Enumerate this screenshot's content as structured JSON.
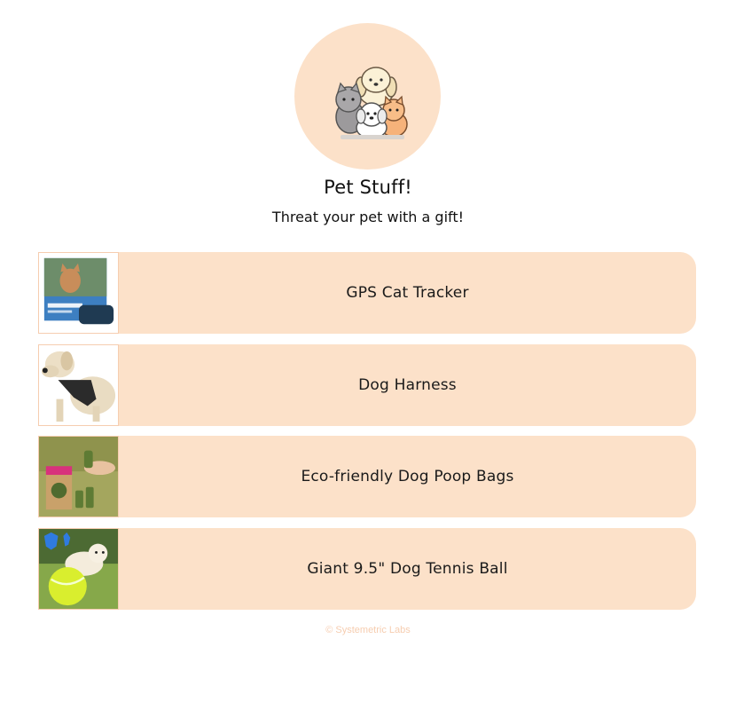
{
  "profile": {
    "avatar_icon": "pets-group-icon",
    "title": "Pet Stuff!",
    "subtitle": "Threat your pet with a gift!"
  },
  "links": [
    {
      "label": "GPS Cat Tracker",
      "thumb_icon": "gps-cat-tracker-thumbnail"
    },
    {
      "label": "Dog Harness",
      "thumb_icon": "dog-harness-thumbnail"
    },
    {
      "label": "Eco-friendly Dog Poop Bags",
      "thumb_icon": "dog-poop-bags-thumbnail"
    },
    {
      "label": "Giant 9.5\" Dog Tennis Ball",
      "thumb_icon": "dog-tennis-ball-thumbnail"
    }
  ],
  "footer": {
    "text": "© Systemetric Labs"
  },
  "colors": {
    "accent": "#fce1c9",
    "border": "#f6cdb0",
    "footer": "#f6cdb0"
  }
}
